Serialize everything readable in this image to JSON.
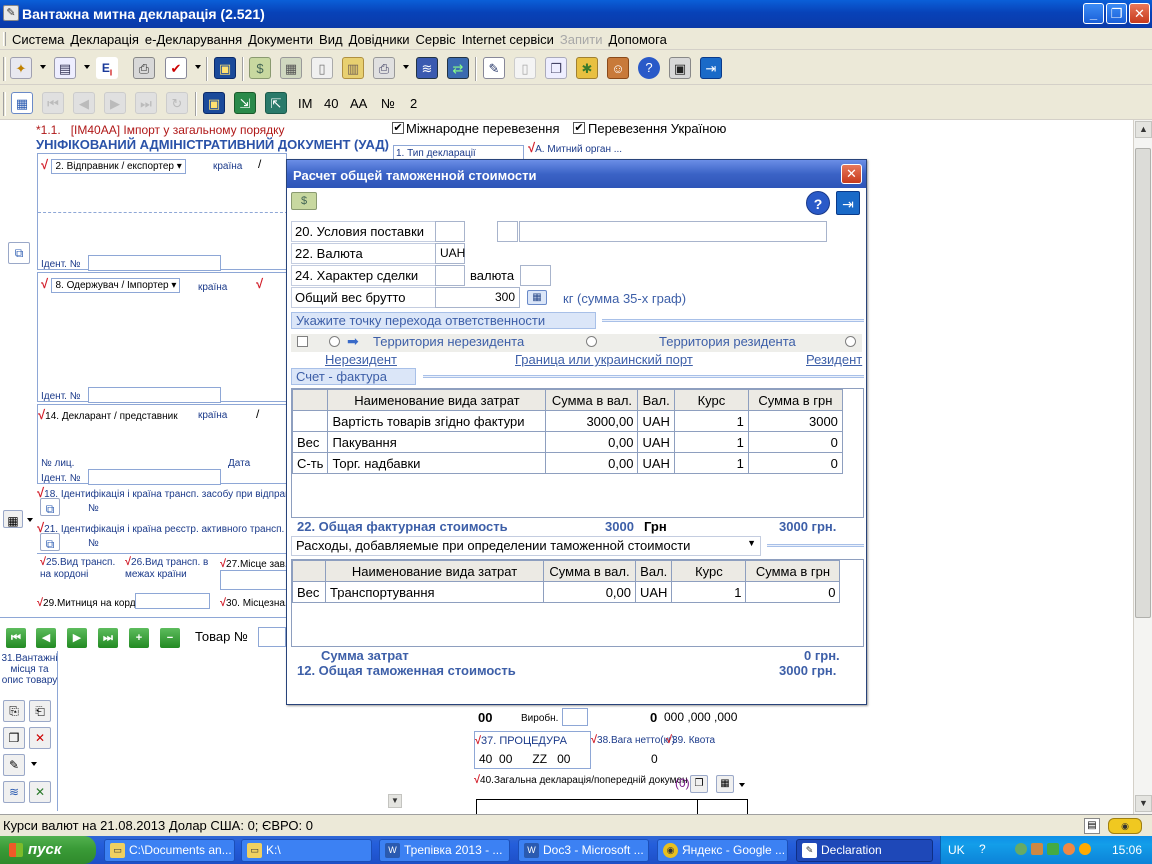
{
  "window": {
    "title": "Вантажна митна декларація (2.521)"
  },
  "menu": [
    "Система",
    "Декларація",
    "е-Декларування",
    "Документи",
    "Вид",
    "Довідники",
    "Сервіс",
    "Internet сервіси",
    "Запити",
    "Допомога"
  ],
  "menu_disabled": "Запити",
  "toolbar2": {
    "type": "ІМ",
    "code": "40",
    "code2": "АА",
    "num_label": "№",
    "num": "2"
  },
  "form": {
    "header_code": "*1.1.",
    "header_text": "[ІМ40АА] Імпорт у загальному порядку",
    "doc_title": "УНІФІКОВАНИЙ АДМІНІСТРАТИВНИЙ ДОКУМЕНТ (УАД)",
    "chk_international": "Міжнародне перевезення",
    "chk_ukraine": "Перевезення Україною",
    "box1": "1. Тип декларації",
    "boxA": "А. Митний орган ...",
    "sender": "2. Відправник / експортер",
    "country": "країна",
    "ident": "Ідент. №",
    "receiver": "8. Одержувач / Імпортер",
    "declarant": "14. Декларант / представник",
    "licence": "№ лиц.",
    "date": "Дата",
    "box18": "18. Ідентифікація і країна трансп. засобу при відправлен...",
    "box21": "21. Ідентифікація і країна реєстр. активного трансп. засо...",
    "no": "№",
    "box25": "25.Вид трансп. на кордоні",
    "box26": "26.Вид трансп. в межах країни",
    "box27": "27.Місце зав...",
    "box29": "29.Митниця на кордоні",
    "box30": "30. Місцезна...",
    "tovar_no": "Товар №",
    "box31": "31.Вантажні місця та опис товару",
    "val00": "00",
    "vyrob": "Виробн.",
    "num0": "0",
    "mask": "000 ,000 ,000",
    "box37": "37. ПРОЦЕДУРА",
    "box38": "38.Вага нетто(кг)",
    "box39": "39. Квота",
    "proc1": "40",
    "proc2": "00",
    "proc3": "ZZ",
    "proc4": "00",
    "netto": "0",
    "box40": "40.Загальна декларація/попередній докумен",
    "box40_count": "(0)"
  },
  "statusbar": {
    "rates": "Курси валют на 21.08.2013  Долар США: 0; ЄВРО: 0"
  },
  "taskbar": {
    "start": "пуск",
    "tasks": [
      "C:\\Documents an...",
      "K:\\",
      "Трепівка 2013 - ...",
      "Doc3 - Microsoft ...",
      "Яндекс - Google ...",
      "Declaration"
    ],
    "lang": "UK",
    "time": "15:06"
  },
  "dialog": {
    "title": "Расчет общей таможенной стоимости",
    "delivery_label": "20. Условия поставки",
    "currency_label": "22. Валюта",
    "currency_value": "UAH",
    "deal_label": "24. Характер сделки",
    "deal_currency_label": "валюта",
    "weight_label": "Общий вес брутто",
    "weight_value": "300",
    "weight_hint": "кг  (сумма 35-х граф)",
    "transfer_hdr": "Укажите точку перехода ответственности",
    "territory_nonres": "Территория  нерезидента",
    "territory_res": "Территория  резидента",
    "link_nonres": "Нерезидент",
    "link_border": "Граница или  украинский порт",
    "link_res": "Резидент",
    "invoice_hdr": "Счет - фактура",
    "table_headers": [
      "Наименование вида затрат",
      "Сумма в вал.",
      "Вал.",
      "Курс",
      "Сумма в грн"
    ],
    "invoice_rows": [
      {
        "prefix": "",
        "name": "Вартість товарів згідно фактури",
        "sum": "3000,00",
        "cur": "UAH",
        "rate": "1",
        "uah": "3000"
      },
      {
        "prefix": "Вес",
        "name": "Пакування",
        "sum": "0,00",
        "cur": "UAH",
        "rate": "1",
        "uah": "0"
      },
      {
        "prefix": "С-ть",
        "name": "Торг. надбавки",
        "sum": "0,00",
        "cur": "UAH",
        "rate": "1",
        "uah": "0"
      }
    ],
    "invoice_total_label": "22. Общая фактурная стоимость",
    "invoice_total_val": "3000",
    "invoice_total_cur": "Грн",
    "invoice_total_uah": "3000  грн.",
    "expenses_select": "Расходы, добавляемые при определении таможенной стоимости",
    "expense_rows": [
      {
        "prefix": "Вес",
        "name": "Транспортування",
        "sum": "0,00",
        "cur": "UAH",
        "rate": "1",
        "uah": "0"
      }
    ],
    "expenses_total_label": "Сумма затрат",
    "expenses_total_val": "0  грн.",
    "customs_total_label": "12. Общая таможенная стоимость",
    "customs_total_val": "3000  грн."
  }
}
